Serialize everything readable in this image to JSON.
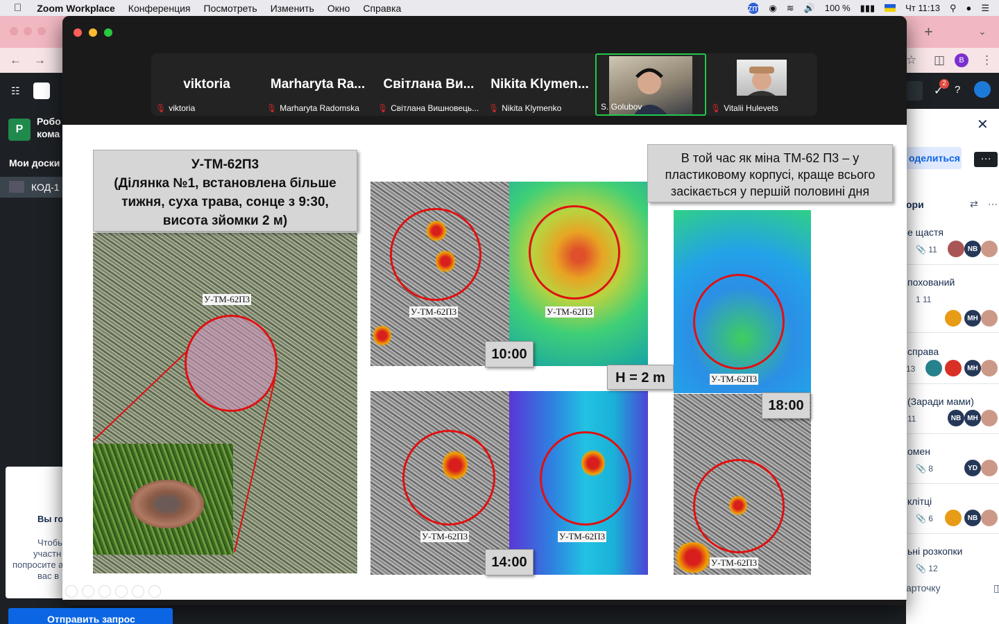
{
  "menubar": {
    "app": "Zoom Workplace",
    "items": [
      "Конференция",
      "Посмотреть",
      "Изменить",
      "Окно",
      "Справка"
    ],
    "battery": "100 %",
    "clock": "Чт 11:13"
  },
  "trello": {
    "workspace_letter": "P",
    "workspace_name_1": "Робо",
    "workspace_name_2": "кома",
    "my_boards": "Мои доски",
    "board_item": "КОД-1",
    "share_button": "оделиться",
    "list_header": "ори",
    "notification_count": "2",
    "profile_letter": "B",
    "cards": [
      {
        "title": "е щастя",
        "meta": "11"
      },
      {
        "title": "похований",
        "meta": "1   11"
      },
      {
        "title": "справа",
        "meta": "13"
      },
      {
        "title": "(Заради мами)",
        "meta": "11"
      },
      {
        "title": "омен",
        "meta": "8"
      },
      {
        "title": "клітці",
        "meta": "6"
      },
      {
        "title": "ьні розкопки",
        "meta": "12"
      }
    ],
    "add_card": "арточку",
    "side_text_1": "Вы го",
    "side_text_2": "Чтобы",
    "side_text_3": "участн",
    "side_text_4": "попросите а",
    "side_text_5": "вас в",
    "side_button": "Отправить запрос"
  },
  "zoom": {
    "participants": [
      {
        "big": "viktoria",
        "name": "viktoria"
      },
      {
        "big": "Marharyta Ra...",
        "name": "Marharyta Radomska"
      },
      {
        "big": "Світлана Ви...",
        "name": "Світлана Вишновець..."
      },
      {
        "big": "Nikita Klymen...",
        "name": "Nikita Klymenko"
      },
      {
        "big": "",
        "name": "S. Golubov"
      },
      {
        "big": "",
        "name": "Vitalii Hulevets"
      }
    ],
    "slide": {
      "callout_left": [
        "У-ТМ-62П3",
        "(Ділянка №1, встановлена більше",
        "тижня, суха трава, сонце з 9:30,",
        "висота зйомки 2 м)"
      ],
      "callout_right": [
        "В той час як міна ТМ-62 П3 – у",
        "пластиковому корпусі, краще всього",
        "засікається у першій половині дня"
      ],
      "mine_label": "У-ТМ-62П3",
      "time_1": "10:00",
      "time_2": "14:00",
      "time_3": "18:00",
      "height": "H = 2 m"
    }
  }
}
